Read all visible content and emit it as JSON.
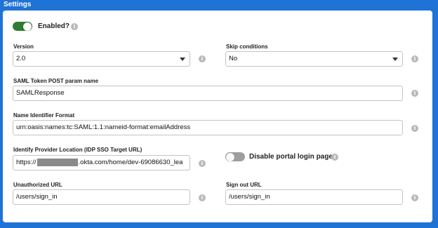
{
  "header": {
    "title": "Settings"
  },
  "settings": {
    "enabled": {
      "label": "Enabled?",
      "on": true
    },
    "version": {
      "label": "Version",
      "value": "2.0"
    },
    "skip_conditions": {
      "label": "Skip conditions",
      "value": "No"
    },
    "saml_token_param": {
      "label": "SAML Token POST param name",
      "value": "SAMLResponse"
    },
    "name_identifier_format": {
      "label": "Name Identifier Format",
      "value": "urn:oasis:names:tc:SAML:1.1:nameid-format:emailAddress"
    },
    "idp_location": {
      "label": "Identify Provider Location (IDP SSO Target URL)",
      "value_prefix": "https://",
      "value_suffix": ".okta.com/home/dev-69086630_lea"
    },
    "disable_portal_login": {
      "label": "Disable portal login page?",
      "on": false
    },
    "unauthorized_url": {
      "label": "Unauthorized URL",
      "value": "/users/sign_in"
    },
    "sign_out_url": {
      "label": "Sign out URL",
      "value": "/users/sign_in"
    }
  },
  "icons": {
    "info": "info-icon",
    "dropdown": "chevron-down-icon"
  },
  "colors": {
    "accent": "#1f73d6",
    "toggle_on": "#2e7d32",
    "toggle_off": "#9e9e9e"
  }
}
